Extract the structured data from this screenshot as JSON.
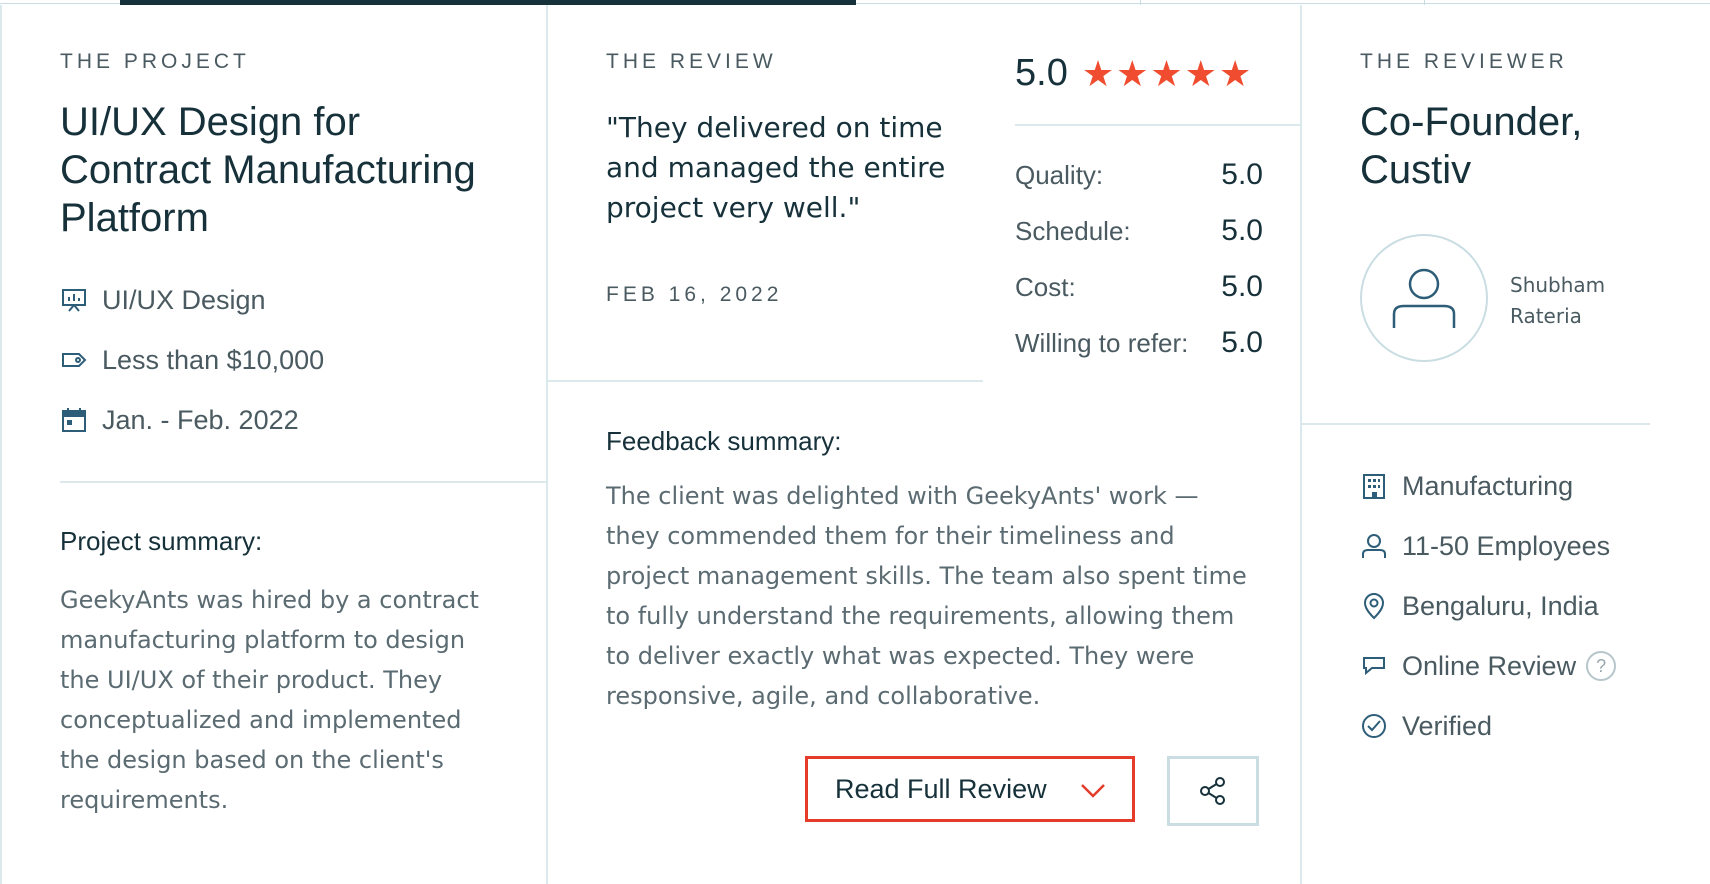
{
  "project": {
    "eyebrow": "THE PROJECT",
    "title": "UI/UX Design for Contract Manufacturing Platform",
    "service": "UI/UX Design",
    "budget": "Less than $10,000",
    "dates": "Jan. - Feb. 2022",
    "summary_heading": "Project summary:",
    "summary": "GeekyAnts was hired by a contract manufacturing platform to design the UI/UX of their product. They conceptualized and implemented the design based on the client's requirements.",
    "icons": {
      "service": "presentation-chart-icon",
      "budget": "price-tag-icon",
      "dates": "calendar-icon"
    }
  },
  "review": {
    "eyebrow": "THE REVIEW",
    "quote": "\"They delivered on time and managed the entire project very well.\"",
    "date": "FEB 16, 2022",
    "overall_score": "5.0",
    "star_count": 5,
    "ratings": [
      {
        "label": "Quality:",
        "value": "5.0"
      },
      {
        "label": "Schedule:",
        "value": "5.0"
      },
      {
        "label": "Cost:",
        "value": "5.0"
      },
      {
        "label": "Willing to refer:",
        "value": "5.0"
      }
    ],
    "feedback_heading": "Feedback summary:",
    "feedback": "The client was delighted with GeekyAnts' work — they commended them for their timeliness and project management skills. The team also spent time to fully understand the requirements, allowing them to deliver exactly what was expected. They were responsive, agile, and collaborative.",
    "read_full_label": "Read Full Review",
    "colors": {
      "star": "#f04d30",
      "button_border": "#e53b2b"
    }
  },
  "reviewer": {
    "eyebrow": "THE REVIEWER",
    "title": "Co-Founder, Custiv",
    "name": "Shubham Rateria",
    "industry": "Manufacturing",
    "size": "11-50 Employees",
    "location": "Bengaluru, India",
    "review_type": "Online Review",
    "verified": "Verified",
    "help_glyph": "?",
    "icons": {
      "industry": "building-icon",
      "size": "user-icon",
      "location": "map-pin-icon",
      "review_type": "chat-bubble-icon",
      "verified": "check-circle-icon",
      "avatar": "user-avatar-icon"
    }
  }
}
